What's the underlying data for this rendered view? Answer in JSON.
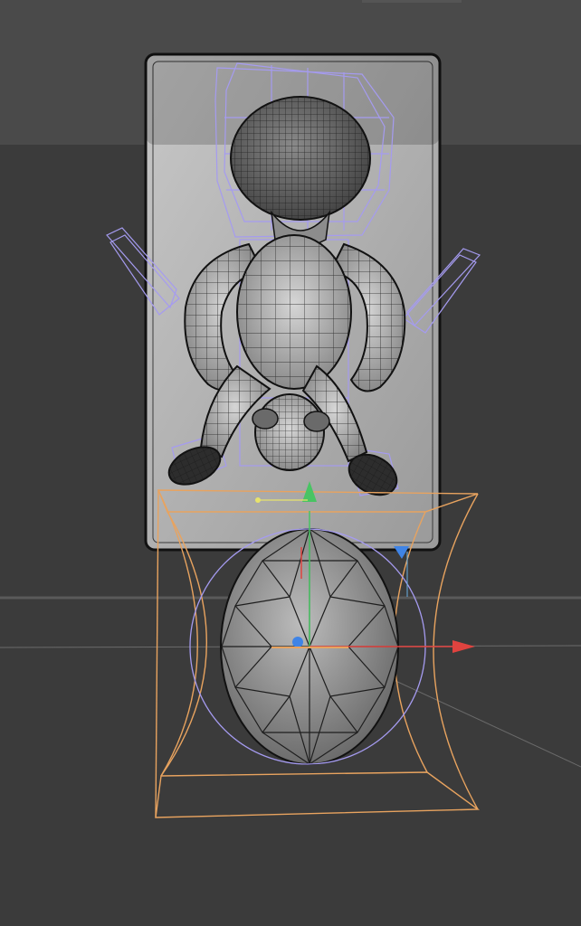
{
  "viewport": {
    "label": "",
    "background": "#3b3b3b",
    "upper_band": "#4a4a4a",
    "horizon_color": "#5a5a5a"
  },
  "colors": {
    "wireframe": "#a59bf0",
    "deformer": "#e8a35f",
    "axis_x": "#e0433f",
    "axis_y": "#48c463",
    "axis_z": "#3f84e6",
    "mesh_fill": "#b9b9b9",
    "mesh_line": "#1e1e1e",
    "backplate": "#bdbdbd"
  },
  "icons": {
    "gizmo": "move-gizmo-icon",
    "handle": "deformer-handle-icon"
  }
}
